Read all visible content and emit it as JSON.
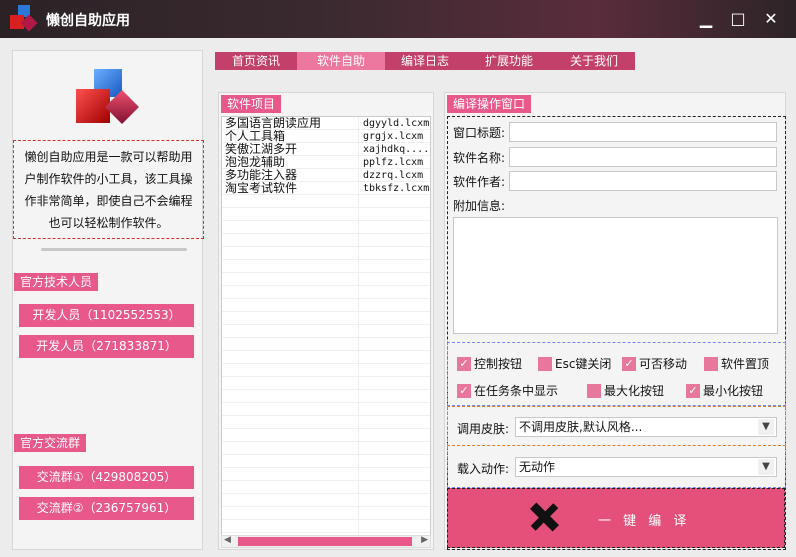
{
  "title": "懒创自助应用",
  "window_buttons": {
    "minimize": "▁",
    "maximize": "□",
    "close": "✕"
  },
  "nav": {
    "tabs": [
      {
        "label": "首页资讯"
      },
      {
        "label": "软件自助"
      },
      {
        "label": "编译日志"
      },
      {
        "label": "扩展功能"
      },
      {
        "label": "关于我们"
      }
    ],
    "active": 1
  },
  "sidebar": {
    "description": "懒创自助应用是一款可以帮助用户制作软件的小工具，该工具操作非常简单，即使自己不会编程也可以轻松制作软件。",
    "staff_title": "官方技术人员",
    "staff": [
      {
        "label": "开发人员（1102552553）"
      },
      {
        "label": "开发人员（271833871）"
      }
    ],
    "groups_title": "官方交流群",
    "groups": [
      {
        "label": "交流群①（429808205）"
      },
      {
        "label": "交流群②（236757961）"
      }
    ]
  },
  "projects": {
    "title": "软件项目",
    "items": [
      {
        "name": "多国语言朗读应用",
        "file": "dgyyld.lcxm"
      },
      {
        "name": "个人工具箱",
        "file": "grgjx.lcxm"
      },
      {
        "name": "笑傲江湖多开",
        "file": "xajhdkq...."
      },
      {
        "name": "泡泡龙辅助",
        "file": "pplfz.lcxm"
      },
      {
        "name": "多功能注入器",
        "file": "dzzrq.lcxm"
      },
      {
        "name": "淘宝考试软件",
        "file": "tbksfz.lcxm"
      }
    ]
  },
  "compile": {
    "title": "编译操作窗口",
    "window_title_label": "窗口标题:",
    "window_title_value": "",
    "name_label": "软件名称:",
    "name_value": "",
    "author_label": "软件作者:",
    "author_value": "",
    "extra_label": "附加信息:",
    "extra_value": "",
    "options": [
      {
        "label": "控制按钮",
        "checked": true
      },
      {
        "label": "Esc键关闭",
        "checked": false
      },
      {
        "label": "可否移动",
        "checked": true
      },
      {
        "label": "软件置顶",
        "checked": false
      },
      {
        "label": "在任务条中显示",
        "checked": true
      },
      {
        "label": "最大化按钮",
        "checked": false
      },
      {
        "label": "最小化按钮",
        "checked": true
      }
    ],
    "skin_label": "调用皮肤:",
    "skin_value": "不调用皮肤,默认风格...",
    "action_label": "载入动作:",
    "action_value": "无动作",
    "compile_button": "一 键 编 译"
  },
  "colors": {
    "accent": "#e8588a",
    "button": "#e4507a"
  }
}
